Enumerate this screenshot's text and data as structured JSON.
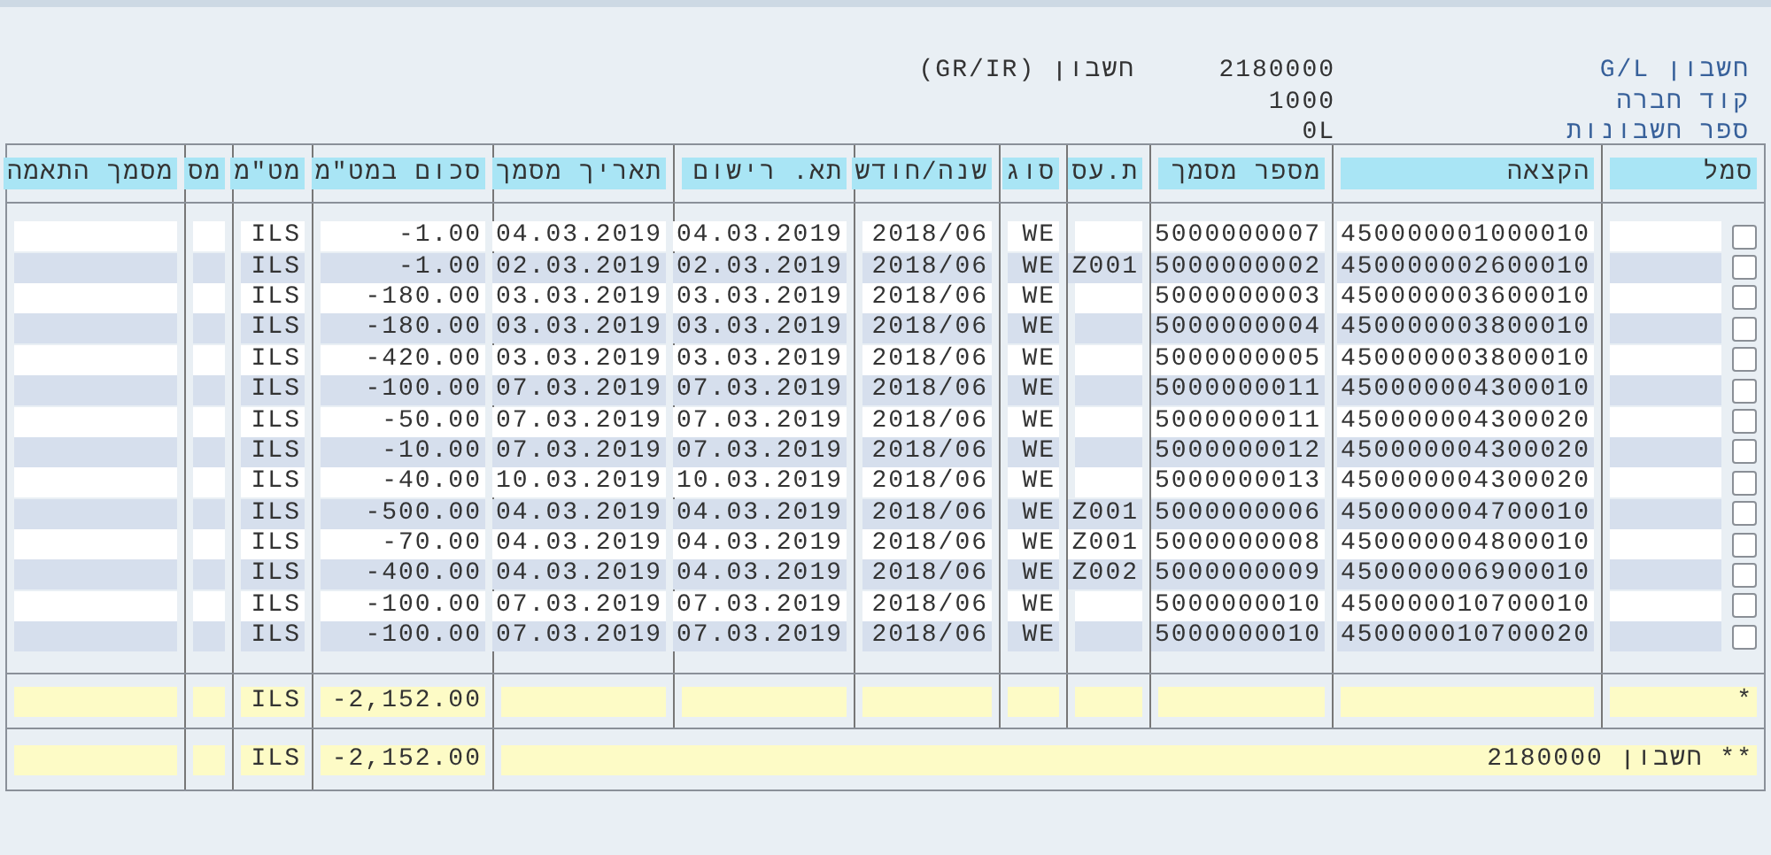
{
  "header": {
    "fields": [
      {
        "label": "חשבון G/L",
        "value": "2180000",
        "description": "חשבון (GR/IR)"
      },
      {
        "label": "קוד חברה",
        "value": "1000"
      },
      {
        "label": "ספר חשבונות",
        "value": "0L"
      }
    ]
  },
  "table": {
    "columns": [
      "סמל",
      "הקצאה",
      "מספר מסמך",
      "ת.עס",
      "סוג",
      "שנה/חודש",
      "תא. רישום",
      "תאריך מסמך",
      "סכום במט\"מ",
      "מט\"מ",
      "מס",
      "מסמך התאמה"
    ],
    "rows": [
      {
        "checked": false,
        "assignment": "450000001000010",
        "doc_no": "5000000007",
        "bus_area": "",
        "type": "WE",
        "period": "2018/06",
        "posting_date": "04.03.2019",
        "doc_date": "04.03.2019",
        "amount": "-1.00",
        "currency": "ILS"
      },
      {
        "checked": false,
        "assignment": "450000002600010",
        "doc_no": "5000000002",
        "bus_area": "Z001",
        "type": "WE",
        "period": "2018/06",
        "posting_date": "02.03.2019",
        "doc_date": "02.03.2019",
        "amount": "-1.00",
        "currency": "ILS"
      },
      {
        "checked": false,
        "assignment": "450000003600010",
        "doc_no": "5000000003",
        "bus_area": "",
        "type": "WE",
        "period": "2018/06",
        "posting_date": "03.03.2019",
        "doc_date": "03.03.2019",
        "amount": "-180.00",
        "currency": "ILS"
      },
      {
        "checked": false,
        "assignment": "450000003800010",
        "doc_no": "5000000004",
        "bus_area": "",
        "type": "WE",
        "period": "2018/06",
        "posting_date": "03.03.2019",
        "doc_date": "03.03.2019",
        "amount": "-180.00",
        "currency": "ILS"
      },
      {
        "checked": false,
        "assignment": "450000003800010",
        "doc_no": "5000000005",
        "bus_area": "",
        "type": "WE",
        "period": "2018/06",
        "posting_date": "03.03.2019",
        "doc_date": "03.03.2019",
        "amount": "-420.00",
        "currency": "ILS"
      },
      {
        "checked": false,
        "assignment": "450000004300010",
        "doc_no": "5000000011",
        "bus_area": "",
        "type": "WE",
        "period": "2018/06",
        "posting_date": "07.03.2019",
        "doc_date": "07.03.2019",
        "amount": "-100.00",
        "currency": "ILS"
      },
      {
        "checked": false,
        "assignment": "450000004300020",
        "doc_no": "5000000011",
        "bus_area": "",
        "type": "WE",
        "period": "2018/06",
        "posting_date": "07.03.2019",
        "doc_date": "07.03.2019",
        "amount": "-50.00",
        "currency": "ILS"
      },
      {
        "checked": false,
        "assignment": "450000004300020",
        "doc_no": "5000000012",
        "bus_area": "",
        "type": "WE",
        "period": "2018/06",
        "posting_date": "07.03.2019",
        "doc_date": "07.03.2019",
        "amount": "-10.00",
        "currency": "ILS"
      },
      {
        "checked": false,
        "assignment": "450000004300020",
        "doc_no": "5000000013",
        "bus_area": "",
        "type": "WE",
        "period": "2018/06",
        "posting_date": "10.03.2019",
        "doc_date": "10.03.2019",
        "amount": "-40.00",
        "currency": "ILS"
      },
      {
        "checked": false,
        "assignment": "450000004700010",
        "doc_no": "5000000006",
        "bus_area": "Z001",
        "type": "WE",
        "period": "2018/06",
        "posting_date": "04.03.2019",
        "doc_date": "04.03.2019",
        "amount": "-500.00",
        "currency": "ILS"
      },
      {
        "checked": false,
        "assignment": "450000004800010",
        "doc_no": "5000000008",
        "bus_area": "Z001",
        "type": "WE",
        "period": "2018/06",
        "posting_date": "04.03.2019",
        "doc_date": "04.03.2019",
        "amount": "-70.00",
        "currency": "ILS"
      },
      {
        "checked": false,
        "assignment": "450000006900010",
        "doc_no": "5000000009",
        "bus_area": "Z002",
        "type": "WE",
        "period": "2018/06",
        "posting_date": "04.03.2019",
        "doc_date": "04.03.2019",
        "amount": "-400.00",
        "currency": "ILS"
      },
      {
        "checked": false,
        "assignment": "450000010700010",
        "doc_no": "5000000010",
        "bus_area": "",
        "type": "WE",
        "period": "2018/06",
        "posting_date": "07.03.2019",
        "doc_date": "07.03.2019",
        "amount": "-100.00",
        "currency": "ILS"
      },
      {
        "checked": false,
        "assignment": "450000010700020",
        "doc_no": "5000000010",
        "bus_area": "",
        "type": "WE",
        "period": "2018/06",
        "posting_date": "07.03.2019",
        "doc_date": "07.03.2019",
        "amount": "-100.00",
        "currency": "ILS"
      }
    ],
    "totals": [
      {
        "kind": "subtotal",
        "label": "*",
        "amount": "-2,152.00",
        "currency": "ILS"
      },
      {
        "kind": "account",
        "label": "** חשבון 2180000",
        "amount": "-2,152.00",
        "currency": "ILS"
      }
    ]
  }
}
